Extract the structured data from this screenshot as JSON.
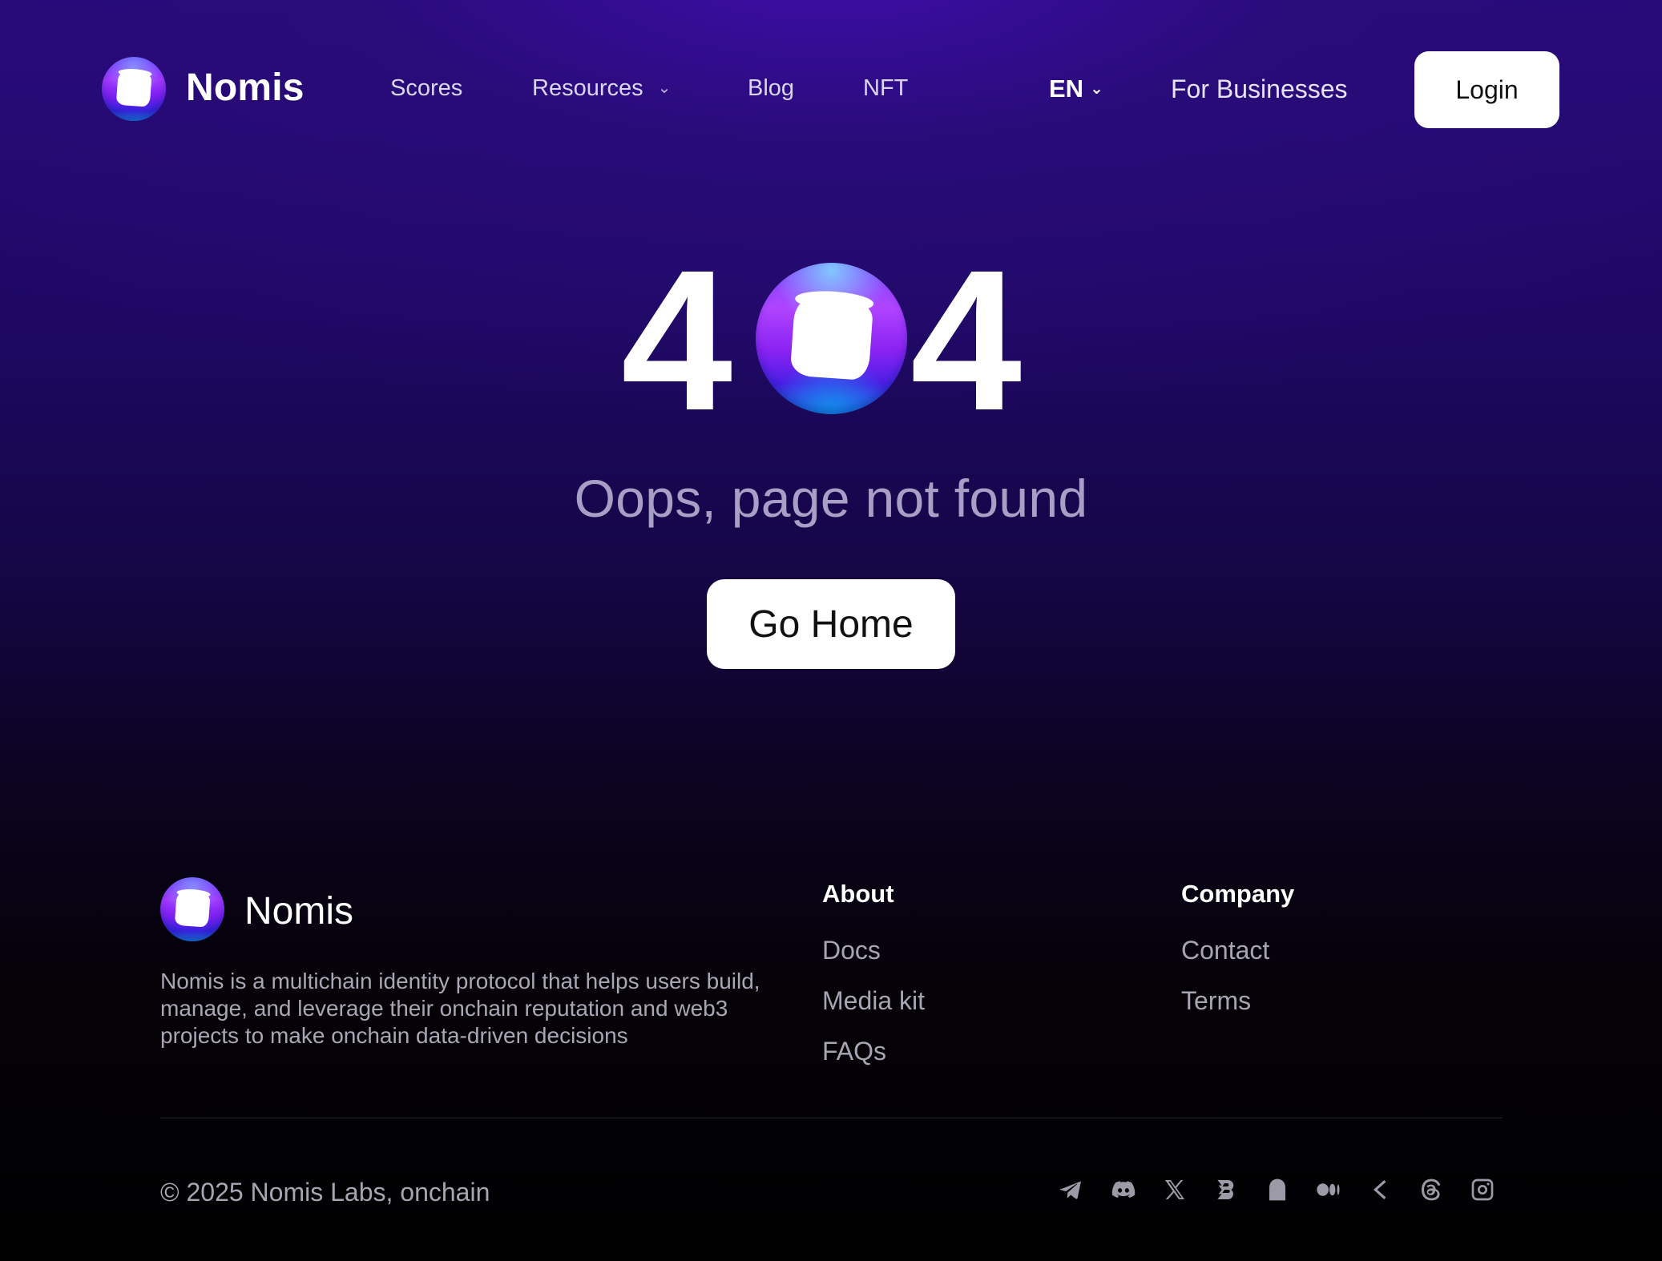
{
  "header": {
    "brand": "Nomis",
    "nav": [
      {
        "label": "Scores"
      },
      {
        "label": "Resources"
      },
      {
        "label": "Blog"
      },
      {
        "label": "NFT"
      }
    ],
    "language": "EN",
    "for_businesses": "For Businesses",
    "login": "Login"
  },
  "hero": {
    "digit_left": "4",
    "digit_right": "4",
    "title": "Oops, page not found",
    "cta": "Go Home"
  },
  "footer": {
    "brand": "Nomis",
    "description": "Nomis is a multichain identity protocol that helps users build, manage, and leverage their onchain reputation and web3 projects to make onchain data-driven decisions",
    "columns": [
      {
        "title": "About",
        "links": [
          "Docs",
          "Media kit",
          "FAQs"
        ]
      },
      {
        "title": "Company",
        "links": [
          "Contact",
          "Terms"
        ]
      }
    ],
    "copyright": "© 2025 Nomis Labs, onchain",
    "social_icons": [
      "telegram-icon",
      "discord-icon",
      "x-icon",
      "galxe-icon",
      "ghost-icon",
      "medium-icon",
      "guild-icon",
      "threads-icon",
      "instagram-icon"
    ]
  },
  "colors": {
    "background_top": "#270a79",
    "background_bottom": "#000000",
    "button_bg": "#ffffff",
    "muted_text": "#a7a5b2",
    "hero_title": "#a79fc5"
  }
}
